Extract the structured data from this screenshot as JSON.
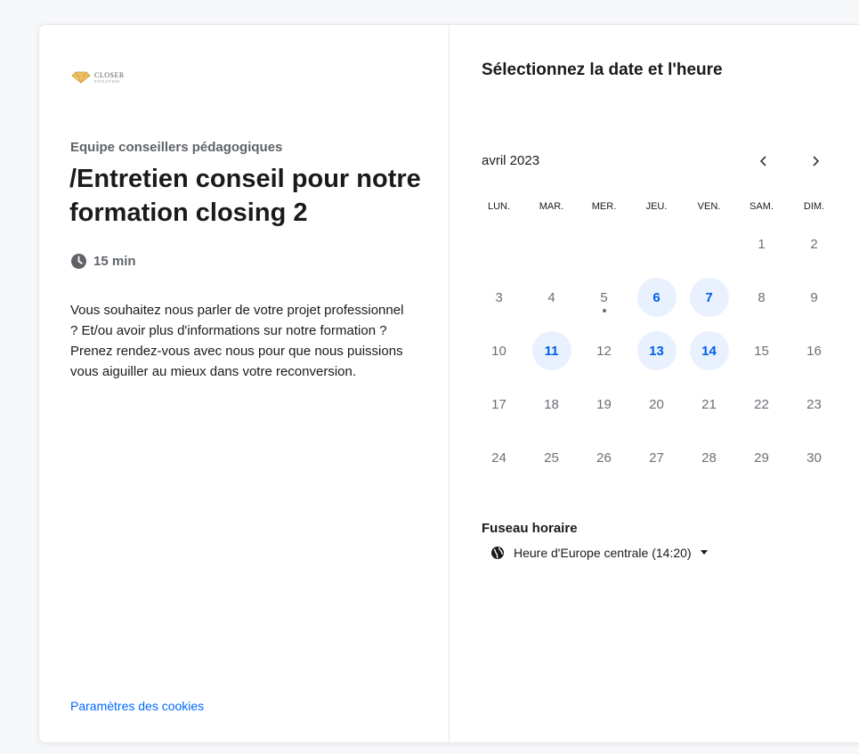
{
  "logo": {
    "main": "CLOSER",
    "sub": "EVOLUTION"
  },
  "event": {
    "organizer": "Equipe conseillers pédagogiques",
    "title": "/Entretien conseil pour notre formation closing 2",
    "duration": "15 min",
    "description": "Vous souhaitez nous parler de votre projet professionnel ? Et/ou avoir plus d'informations sur notre formation ? Prenez rendez-vous avec nous pour que nous puissions vous aiguiller au mieux dans votre reconversion."
  },
  "cookies_link": "Paramètres des cookies",
  "scheduler": {
    "heading": "Sélectionnez la date et l'heure",
    "month": "avril 2023",
    "prev_icon": "chevron-left-icon",
    "next_icon": "chevron-right-icon",
    "weekdays": [
      "LUN.",
      "MAR.",
      "MER.",
      "JEU.",
      "VEN.",
      "SAM.",
      "DIM."
    ],
    "weeks": [
      [
        "",
        "",
        "",
        "",
        "",
        "1",
        "2"
      ],
      [
        "3",
        "4",
        "5",
        "6",
        "7",
        "8",
        "9"
      ],
      [
        "10",
        "11",
        "12",
        "13",
        "14",
        "15",
        "16"
      ],
      [
        "17",
        "18",
        "19",
        "20",
        "21",
        "22",
        "23"
      ],
      [
        "24",
        "25",
        "26",
        "27",
        "28",
        "29",
        "30"
      ]
    ],
    "available_days": [
      "6",
      "7",
      "11",
      "13",
      "14"
    ],
    "today": "5",
    "timezone_label": "Fuseau horaire",
    "timezone": "Heure d'Europe centrale (14:20)"
  },
  "colors": {
    "accent": "#0060e6",
    "available_bg": "#e9f1ff",
    "link": "#0069ff"
  }
}
